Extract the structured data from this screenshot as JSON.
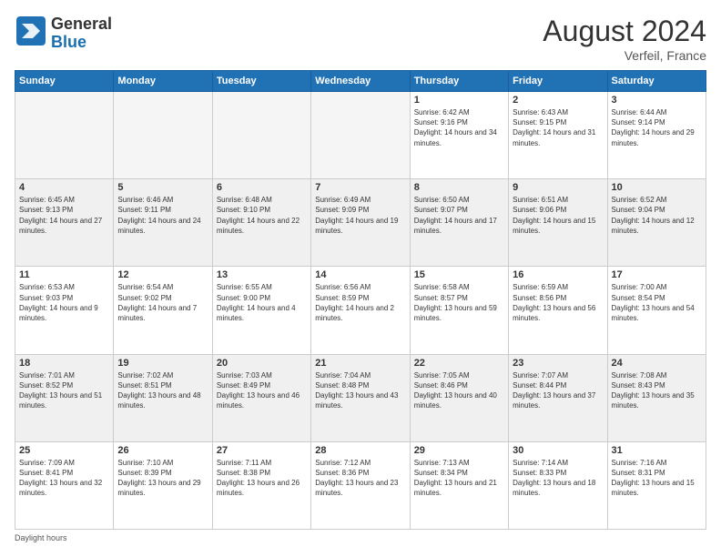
{
  "header": {
    "logo_general": "General",
    "logo_blue": "Blue",
    "month_year": "August 2024",
    "location": "Verfeil, France"
  },
  "weekdays": [
    "Sunday",
    "Monday",
    "Tuesday",
    "Wednesday",
    "Thursday",
    "Friday",
    "Saturday"
  ],
  "footer": {
    "daylight_label": "Daylight hours"
  },
  "weeks": [
    [
      {
        "day": "",
        "sunrise": "",
        "sunset": "",
        "daylight": "",
        "empty": true
      },
      {
        "day": "",
        "sunrise": "",
        "sunset": "",
        "daylight": "",
        "empty": true
      },
      {
        "day": "",
        "sunrise": "",
        "sunset": "",
        "daylight": "",
        "empty": true
      },
      {
        "day": "",
        "sunrise": "",
        "sunset": "",
        "daylight": "",
        "empty": true
      },
      {
        "day": "1",
        "sunrise": "Sunrise: 6:42 AM",
        "sunset": "Sunset: 9:16 PM",
        "daylight": "Daylight: 14 hours and 34 minutes.",
        "empty": false
      },
      {
        "day": "2",
        "sunrise": "Sunrise: 6:43 AM",
        "sunset": "Sunset: 9:15 PM",
        "daylight": "Daylight: 14 hours and 31 minutes.",
        "empty": false
      },
      {
        "day": "3",
        "sunrise": "Sunrise: 6:44 AM",
        "sunset": "Sunset: 9:14 PM",
        "daylight": "Daylight: 14 hours and 29 minutes.",
        "empty": false
      }
    ],
    [
      {
        "day": "4",
        "sunrise": "Sunrise: 6:45 AM",
        "sunset": "Sunset: 9:13 PM",
        "daylight": "Daylight: 14 hours and 27 minutes.",
        "empty": false
      },
      {
        "day": "5",
        "sunrise": "Sunrise: 6:46 AM",
        "sunset": "Sunset: 9:11 PM",
        "daylight": "Daylight: 14 hours and 24 minutes.",
        "empty": false
      },
      {
        "day": "6",
        "sunrise": "Sunrise: 6:48 AM",
        "sunset": "Sunset: 9:10 PM",
        "daylight": "Daylight: 14 hours and 22 minutes.",
        "empty": false
      },
      {
        "day": "7",
        "sunrise": "Sunrise: 6:49 AM",
        "sunset": "Sunset: 9:09 PM",
        "daylight": "Daylight: 14 hours and 19 minutes.",
        "empty": false
      },
      {
        "day": "8",
        "sunrise": "Sunrise: 6:50 AM",
        "sunset": "Sunset: 9:07 PM",
        "daylight": "Daylight: 14 hours and 17 minutes.",
        "empty": false
      },
      {
        "day": "9",
        "sunrise": "Sunrise: 6:51 AM",
        "sunset": "Sunset: 9:06 PM",
        "daylight": "Daylight: 14 hours and 15 minutes.",
        "empty": false
      },
      {
        "day": "10",
        "sunrise": "Sunrise: 6:52 AM",
        "sunset": "Sunset: 9:04 PM",
        "daylight": "Daylight: 14 hours and 12 minutes.",
        "empty": false
      }
    ],
    [
      {
        "day": "11",
        "sunrise": "Sunrise: 6:53 AM",
        "sunset": "Sunset: 9:03 PM",
        "daylight": "Daylight: 14 hours and 9 minutes.",
        "empty": false
      },
      {
        "day": "12",
        "sunrise": "Sunrise: 6:54 AM",
        "sunset": "Sunset: 9:02 PM",
        "daylight": "Daylight: 14 hours and 7 minutes.",
        "empty": false
      },
      {
        "day": "13",
        "sunrise": "Sunrise: 6:55 AM",
        "sunset": "Sunset: 9:00 PM",
        "daylight": "Daylight: 14 hours and 4 minutes.",
        "empty": false
      },
      {
        "day": "14",
        "sunrise": "Sunrise: 6:56 AM",
        "sunset": "Sunset: 8:59 PM",
        "daylight": "Daylight: 14 hours and 2 minutes.",
        "empty": false
      },
      {
        "day": "15",
        "sunrise": "Sunrise: 6:58 AM",
        "sunset": "Sunset: 8:57 PM",
        "daylight": "Daylight: 13 hours and 59 minutes.",
        "empty": false
      },
      {
        "day": "16",
        "sunrise": "Sunrise: 6:59 AM",
        "sunset": "Sunset: 8:56 PM",
        "daylight": "Daylight: 13 hours and 56 minutes.",
        "empty": false
      },
      {
        "day": "17",
        "sunrise": "Sunrise: 7:00 AM",
        "sunset": "Sunset: 8:54 PM",
        "daylight": "Daylight: 13 hours and 54 minutes.",
        "empty": false
      }
    ],
    [
      {
        "day": "18",
        "sunrise": "Sunrise: 7:01 AM",
        "sunset": "Sunset: 8:52 PM",
        "daylight": "Daylight: 13 hours and 51 minutes.",
        "empty": false
      },
      {
        "day": "19",
        "sunrise": "Sunrise: 7:02 AM",
        "sunset": "Sunset: 8:51 PM",
        "daylight": "Daylight: 13 hours and 48 minutes.",
        "empty": false
      },
      {
        "day": "20",
        "sunrise": "Sunrise: 7:03 AM",
        "sunset": "Sunset: 8:49 PM",
        "daylight": "Daylight: 13 hours and 46 minutes.",
        "empty": false
      },
      {
        "day": "21",
        "sunrise": "Sunrise: 7:04 AM",
        "sunset": "Sunset: 8:48 PM",
        "daylight": "Daylight: 13 hours and 43 minutes.",
        "empty": false
      },
      {
        "day": "22",
        "sunrise": "Sunrise: 7:05 AM",
        "sunset": "Sunset: 8:46 PM",
        "daylight": "Daylight: 13 hours and 40 minutes.",
        "empty": false
      },
      {
        "day": "23",
        "sunrise": "Sunrise: 7:07 AM",
        "sunset": "Sunset: 8:44 PM",
        "daylight": "Daylight: 13 hours and 37 minutes.",
        "empty": false
      },
      {
        "day": "24",
        "sunrise": "Sunrise: 7:08 AM",
        "sunset": "Sunset: 8:43 PM",
        "daylight": "Daylight: 13 hours and 35 minutes.",
        "empty": false
      }
    ],
    [
      {
        "day": "25",
        "sunrise": "Sunrise: 7:09 AM",
        "sunset": "Sunset: 8:41 PM",
        "daylight": "Daylight: 13 hours and 32 minutes.",
        "empty": false
      },
      {
        "day": "26",
        "sunrise": "Sunrise: 7:10 AM",
        "sunset": "Sunset: 8:39 PM",
        "daylight": "Daylight: 13 hours and 29 minutes.",
        "empty": false
      },
      {
        "day": "27",
        "sunrise": "Sunrise: 7:11 AM",
        "sunset": "Sunset: 8:38 PM",
        "daylight": "Daylight: 13 hours and 26 minutes.",
        "empty": false
      },
      {
        "day": "28",
        "sunrise": "Sunrise: 7:12 AM",
        "sunset": "Sunset: 8:36 PM",
        "daylight": "Daylight: 13 hours and 23 minutes.",
        "empty": false
      },
      {
        "day": "29",
        "sunrise": "Sunrise: 7:13 AM",
        "sunset": "Sunset: 8:34 PM",
        "daylight": "Daylight: 13 hours and 21 minutes.",
        "empty": false
      },
      {
        "day": "30",
        "sunrise": "Sunrise: 7:14 AM",
        "sunset": "Sunset: 8:33 PM",
        "daylight": "Daylight: 13 hours and 18 minutes.",
        "empty": false
      },
      {
        "day": "31",
        "sunrise": "Sunrise: 7:16 AM",
        "sunset": "Sunset: 8:31 PM",
        "daylight": "Daylight: 13 hours and 15 minutes.",
        "empty": false
      }
    ]
  ]
}
